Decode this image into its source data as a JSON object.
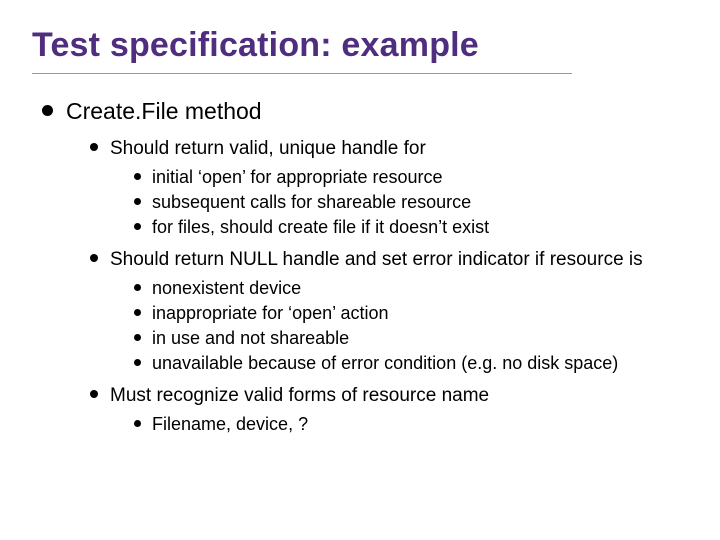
{
  "title": "Test specification: example",
  "l1": {
    "text": "Create.File method",
    "children": [
      {
        "text": "Should return valid, unique handle for",
        "items": [
          "initial ‘open’ for appropriate resource",
          "subsequent calls for shareable resource",
          "for files, should create file if it doesn’t exist"
        ]
      },
      {
        "text": "Should return NULL handle and set error indicator if resource is",
        "items": [
          "nonexistent device",
          "inappropriate for ‘open’ action",
          "in use and not shareable",
          "unavailable because of error condition (e.g. no disk space)"
        ]
      },
      {
        "text": "Must recognize valid forms of resource name",
        "items": [
          "Filename, device, ?"
        ]
      }
    ]
  }
}
